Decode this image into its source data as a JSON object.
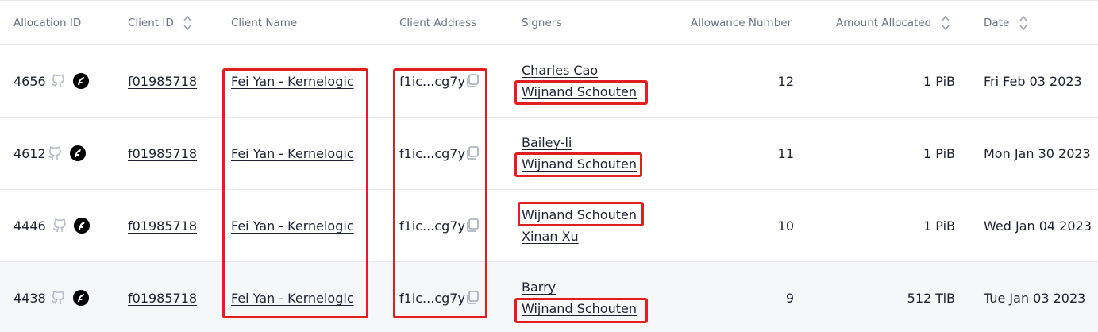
{
  "table": {
    "columns": [
      {
        "key": "allocation_id",
        "label": "Allocation ID",
        "sortable": false
      },
      {
        "key": "client_id",
        "label": "Client ID",
        "sortable": true
      },
      {
        "key": "client_name",
        "label": "Client Name",
        "sortable": false
      },
      {
        "key": "client_address",
        "label": "Client Address",
        "sortable": false
      },
      {
        "key": "signers",
        "label": "Signers",
        "sortable": false
      },
      {
        "key": "allowance_number",
        "label": "Allowance Number",
        "sortable": false
      },
      {
        "key": "amount_allocated",
        "label": "Amount Allocated",
        "sortable": true
      },
      {
        "key": "date",
        "label": "Date",
        "sortable": true
      }
    ],
    "rows": [
      {
        "allocation_id": "4656",
        "client_id": "f01985718",
        "client_name": "Fei Yan - Kernelogic",
        "client_address": "f1ic...cg7y",
        "signers": [
          "Charles Cao",
          "Wijnand Schouten"
        ],
        "allowance_number": "12",
        "amount_allocated": "1 PiB",
        "date": "Fri Feb 03 2023"
      },
      {
        "allocation_id": "4612",
        "client_id": "f01985718",
        "client_name": "Fei Yan - Kernelogic",
        "client_address": "f1ic...cg7y",
        "signers": [
          "Bailey-li",
          "Wijnand Schouten"
        ],
        "allowance_number": "11",
        "amount_allocated": "1 PiB",
        "date": "Mon Jan 30 2023"
      },
      {
        "allocation_id": "4446",
        "client_id": "f01985718",
        "client_name": "Fei Yan - Kernelogic",
        "client_address": "f1ic...cg7y",
        "signers": [
          "Wijnand Schouten",
          "Xinan Xu"
        ],
        "allowance_number": "10",
        "amount_allocated": "1 PiB",
        "date": "Wed Jan 04 2023"
      },
      {
        "allocation_id": "4438",
        "client_id": "f01985718",
        "client_name": "Fei Yan - Kernelogic",
        "client_address": "f1ic...cg7y",
        "signers": [
          "Barry",
          "Wijnand Schouten"
        ],
        "allowance_number": "9",
        "amount_allocated": "512 TiB",
        "date": "Tue Jan 03 2023"
      }
    ]
  },
  "icons": {
    "github": "github-icon",
    "filfox": "filfox-icon",
    "copy": "copy-icon",
    "sort": "sort-icon"
  },
  "colors": {
    "highlight": "#e02020",
    "header_text": "#6b7386",
    "text": "#1f2233",
    "row_shade": "#f6f7f9"
  }
}
